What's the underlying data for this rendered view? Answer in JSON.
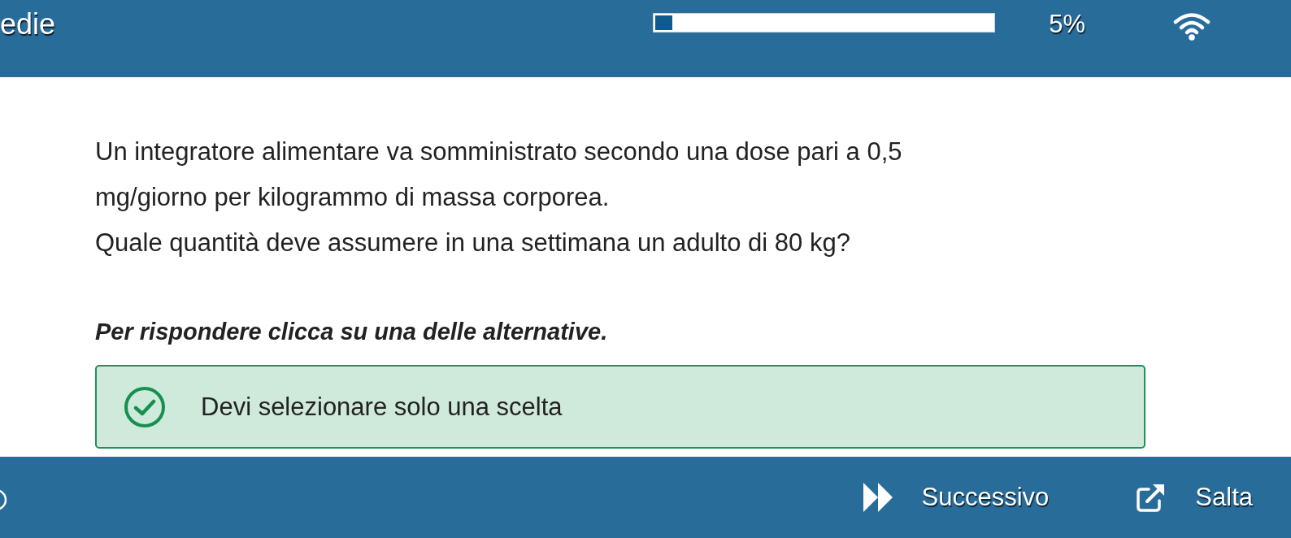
{
  "header": {
    "title": "edie",
    "progress": {
      "level": 0.05,
      "reading": "5%"
    }
  },
  "question": {
    "paragraphs": [
      "Un integratore alimentare va somministrato secondo una dose pari a 0,5 mg/giorno per kilogrammo di massa corporea.",
      "Quale quantità deve assumere in una settimana un adulto di 80 kg?"
    ],
    "instruction": "Per rispondere clicca su una delle alternative."
  },
  "notice": {
    "kind": "success",
    "text": "Devi selezionare solo una scelta"
  },
  "footer": {
    "buttons": [
      {
        "kind": "next",
        "label": "Successivo"
      },
      {
        "kind": "skip",
        "label": "Salta"
      }
    ]
  }
}
